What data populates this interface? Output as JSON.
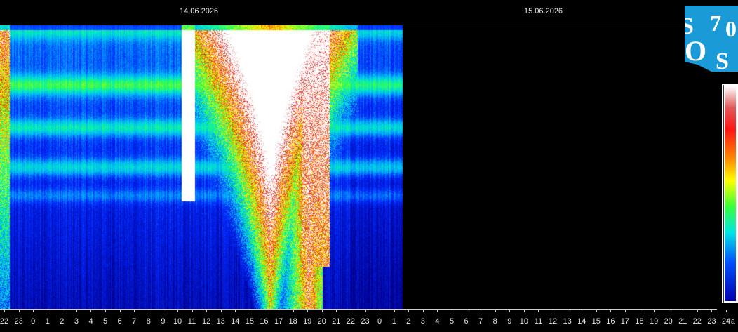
{
  "header": {
    "date_left": "14.06.2026",
    "date_right": "15.06.2026"
  },
  "logo": {
    "letters": [
      "S",
      "7",
      "0",
      "O",
      "S"
    ],
    "color": "#1a9ad6"
  },
  "chart_data": {
    "type": "heatmap",
    "title": "",
    "x_ticks": [
      "22",
      "23",
      "0",
      "1",
      "2",
      "3",
      "4",
      "5",
      "6",
      "7",
      "8",
      "9",
      "10",
      "11",
      "12",
      "13",
      "14",
      "15",
      "16",
      "17",
      "18",
      "19",
      "20",
      "21",
      "22",
      "23",
      "0",
      "1",
      "2",
      "3",
      "4",
      "5",
      "6",
      "7",
      "8",
      "9",
      "10",
      "11",
      "12",
      "13",
      "14",
      "15",
      "16",
      "17",
      "18",
      "19",
      "20",
      "21",
      "22",
      "23",
      "24"
    ],
    "x_unit": "ча",
    "data_extent_hours": [
      22,
      2
    ],
    "background_colormap": "blue → cyan → green (quiet bands), white saturated burst",
    "saturated_interval_hours": [
      10.5,
      21.5
    ],
    "horizontal_bands": "bright cyan-green bands near 12%, 30%, 50% of height",
    "colorbar": [
      "#ffffff",
      "#e25858",
      "#ff1515",
      "#ff8c00",
      "#ffff00",
      "#39ff39",
      "#00e5e5",
      "#0050ff",
      "#0000b0"
    ]
  }
}
